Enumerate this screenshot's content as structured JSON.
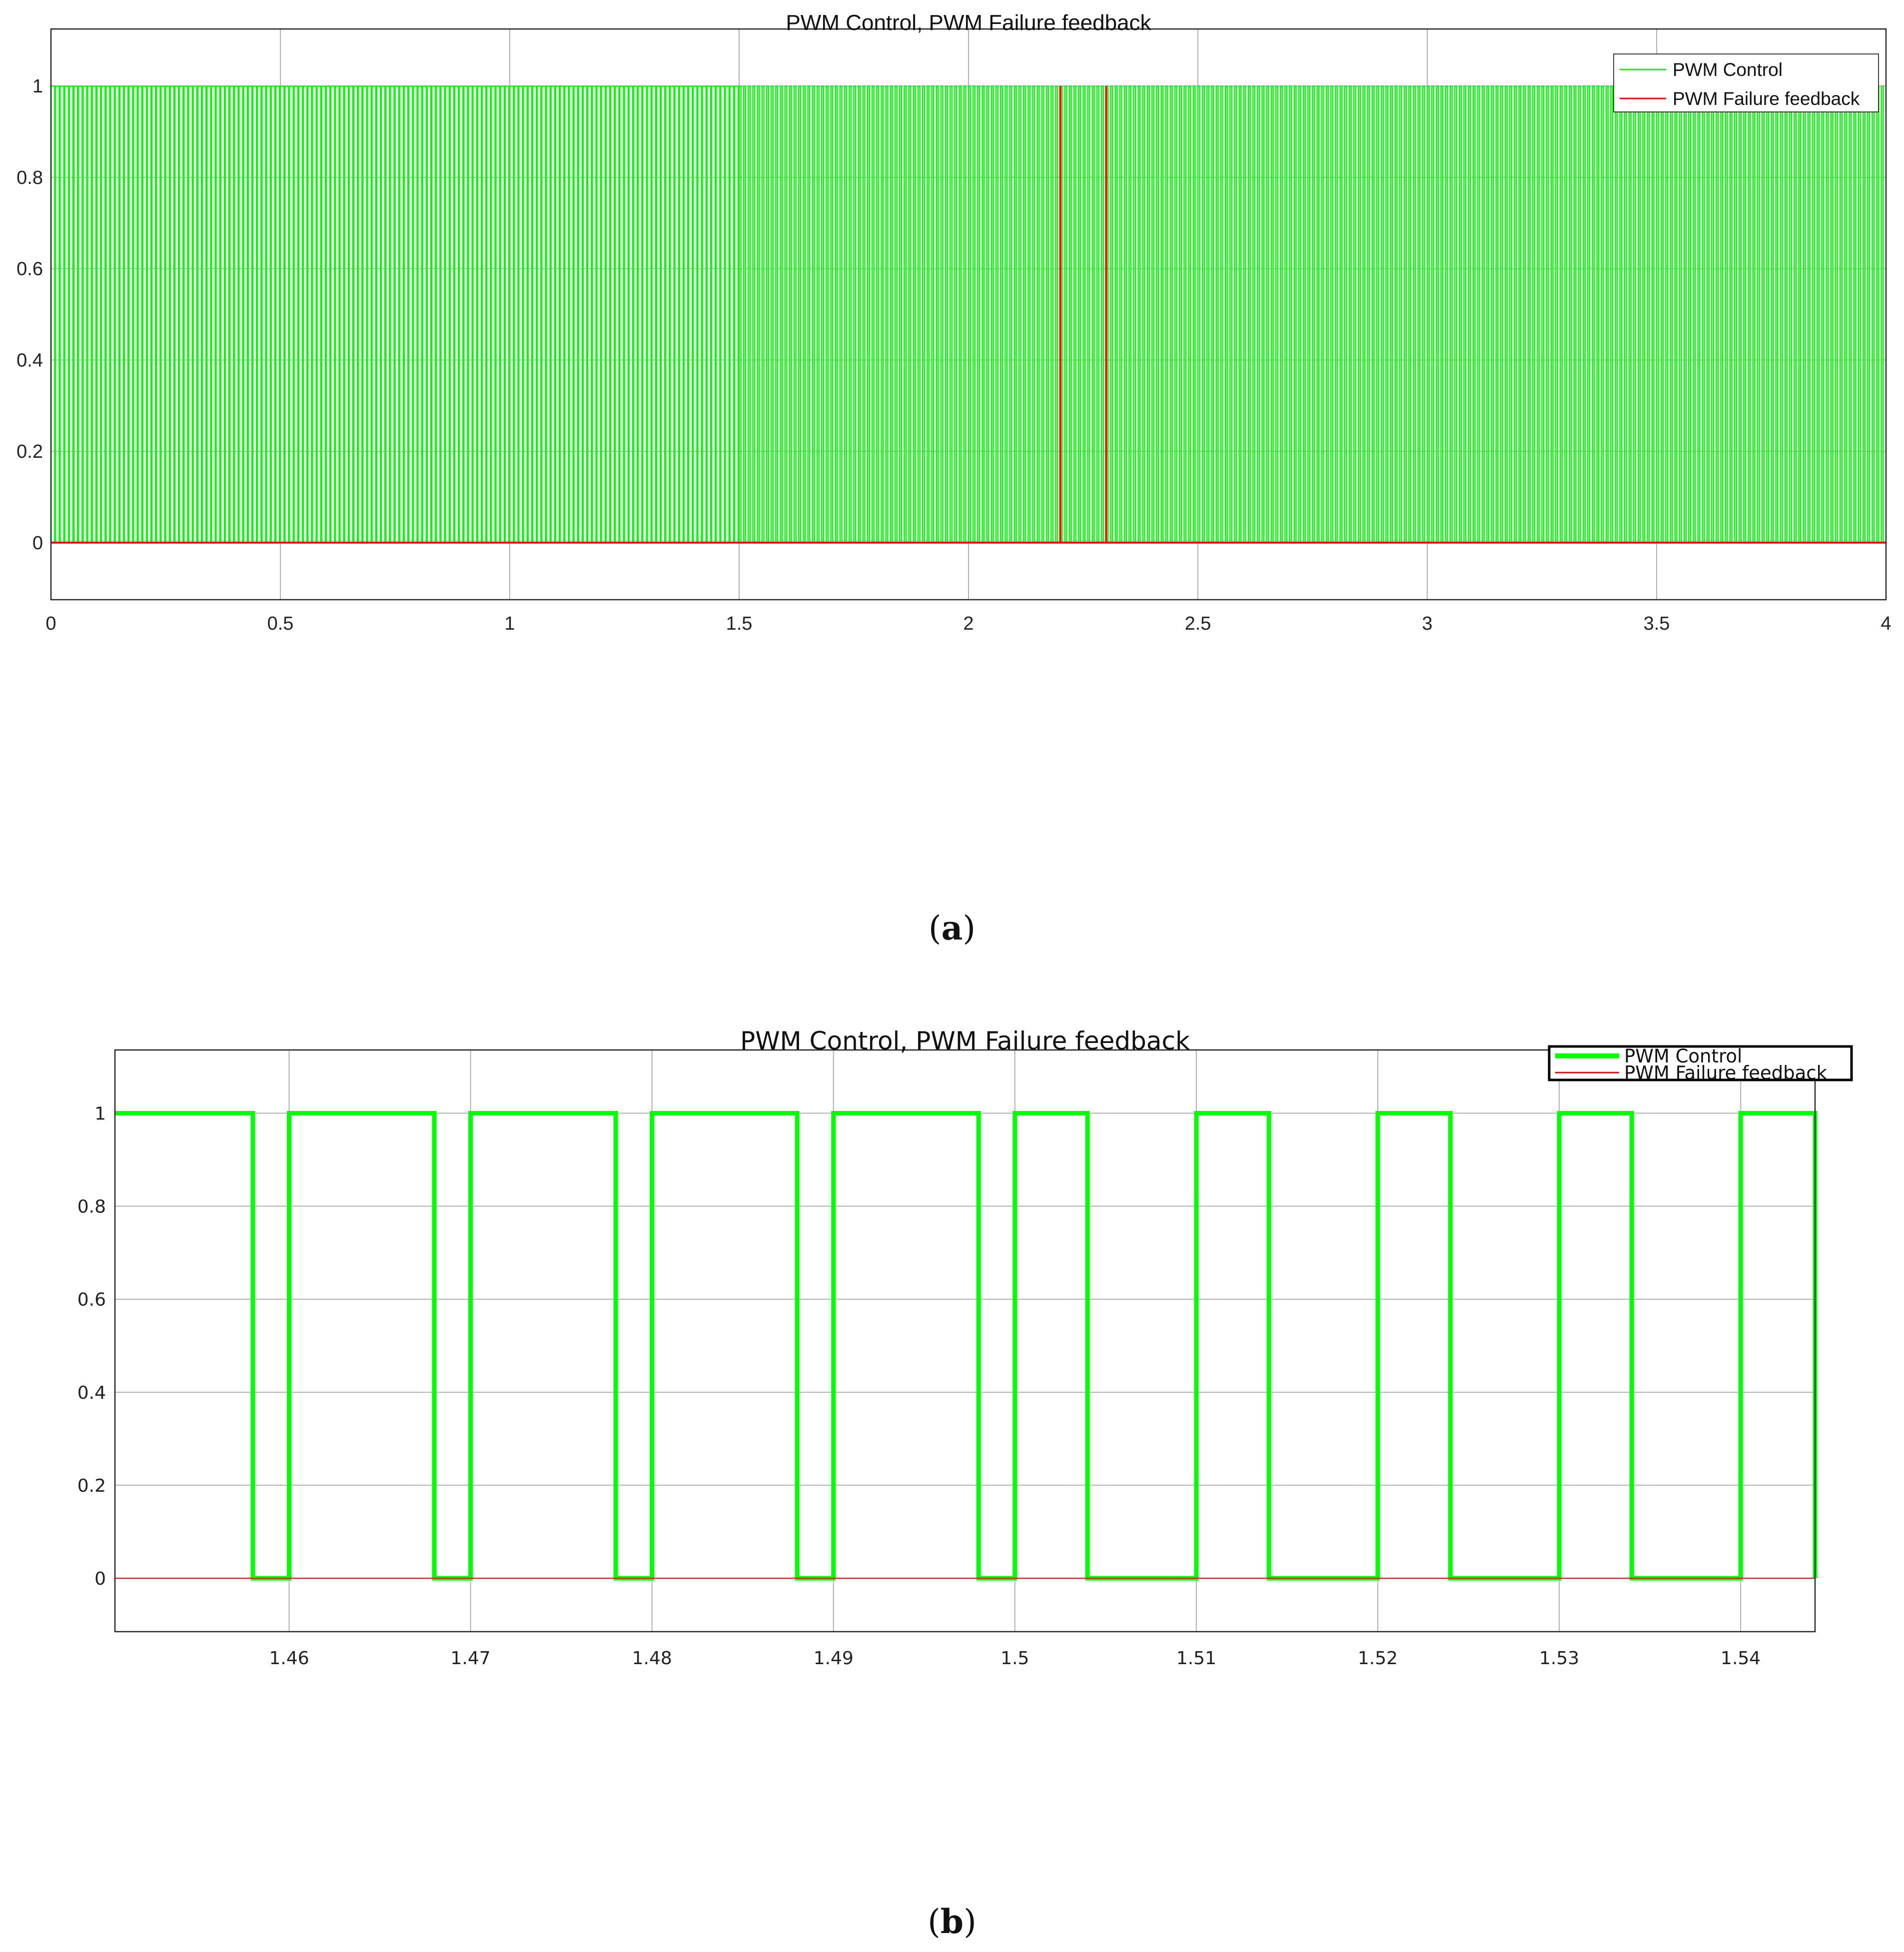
{
  "colors": {
    "pwm_control": "#00ff00",
    "pwm_failure": "#ff0000",
    "grid": "#b0b0b0",
    "axis": "#262626"
  },
  "chart_data": [
    {
      "type": "line",
      "caption_letter": "a",
      "title": "PWM Control, PWM Failure feedback",
      "xlim": [
        0,
        4
      ],
      "ylim": [
        -0.125,
        1.125
      ],
      "xticks": [
        0,
        0.5,
        1,
        1.5,
        2,
        2.5,
        3,
        3.5,
        4
      ],
      "xtick_labels": [
        "0",
        "0.5",
        "1",
        "1.5",
        "2",
        "2.5",
        "3",
        "3.5",
        "4"
      ],
      "yticks": [
        0,
        0.2,
        0.4,
        0.6,
        0.8,
        1
      ],
      "ytick_labels": [
        "0",
        "0.2",
        "0.4",
        "0.6",
        "0.8",
        "1"
      ],
      "grid": true,
      "legend_position": "top-right",
      "series": [
        {
          "name": "PWM Control",
          "kind": "pwm",
          "period": 0.01,
          "duty_segments": [
            {
              "from": 0,
              "to": 1.5,
              "duty": 0.8
            },
            {
              "from": 1.5,
              "to": 4,
              "duty": 0.4
            }
          ]
        },
        {
          "name": "PWM Failure feedback",
          "kind": "pulses",
          "baseline": 0,
          "pulse_times": [
            2.2,
            2.3
          ],
          "pulse_value": 1
        }
      ]
    },
    {
      "type": "line",
      "caption_letter": "b",
      "title": "PWM Control, PWM Failure feedback",
      "xlim": [
        1.4504,
        1.5441
      ],
      "ylim": [
        -0.115,
        1.136
      ],
      "xticks": [
        1.46,
        1.47,
        1.48,
        1.49,
        1.5,
        1.51,
        1.52,
        1.53,
        1.54
      ],
      "xtick_labels": [
        "1.46",
        "1.47",
        "1.48",
        "1.49",
        "1.5",
        "1.51",
        "1.52",
        "1.53",
        "1.54"
      ],
      "yticks": [
        0,
        0.2,
        0.4,
        0.6,
        0.8,
        1
      ],
      "ytick_labels": [
        "0",
        "0.2",
        "0.4",
        "0.6",
        "0.8",
        "1"
      ],
      "grid": true,
      "legend_position": "top-right",
      "series": [
        {
          "name": "PWM Control",
          "kind": "steps",
          "x": [
            1.4504,
            1.458,
            1.458,
            1.46,
            1.46,
            1.468,
            1.468,
            1.47,
            1.47,
            1.478,
            1.478,
            1.48,
            1.48,
            1.488,
            1.488,
            1.49,
            1.49,
            1.498,
            1.498,
            1.5,
            1.5,
            1.504,
            1.504,
            1.51,
            1.51,
            1.514,
            1.514,
            1.52,
            1.52,
            1.524,
            1.524,
            1.53,
            1.53,
            1.534,
            1.534,
            1.54,
            1.54,
            1.5441,
            1.5441
          ],
          "y": [
            1,
            1,
            0,
            0,
            1,
            1,
            0,
            0,
            1,
            1,
            0,
            0,
            1,
            1,
            0,
            0,
            1,
            1,
            0,
            0,
            1,
            1,
            0,
            0,
            1,
            1,
            0,
            0,
            1,
            1,
            0,
            0,
            1,
            1,
            0,
            0,
            1,
            1,
            0
          ]
        },
        {
          "name": "PWM Failure feedback",
          "kind": "constant",
          "value": 0
        }
      ]
    }
  ]
}
